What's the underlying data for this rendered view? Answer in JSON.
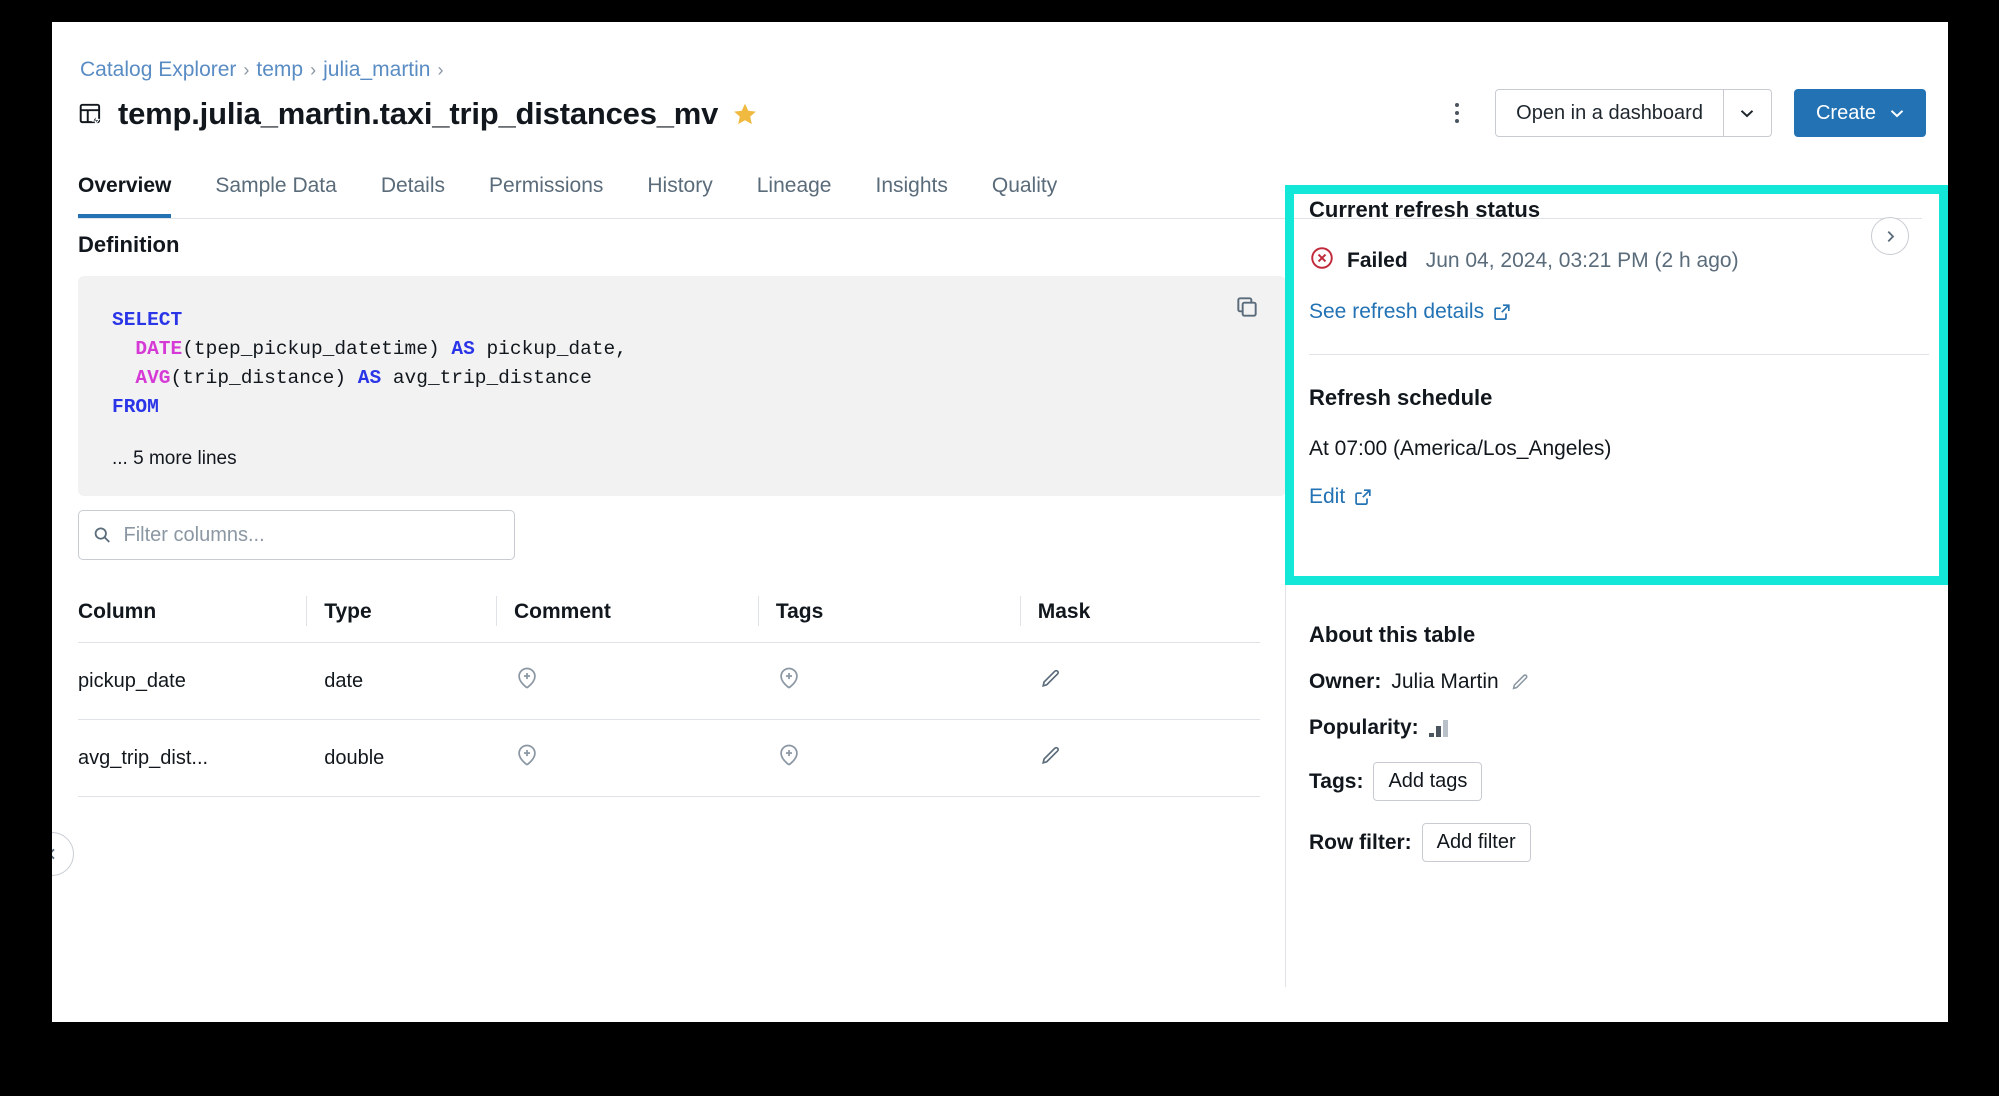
{
  "breadcrumb": {
    "items": [
      "Catalog Explorer",
      "temp",
      "julia_martin"
    ],
    "separator": "›"
  },
  "header": {
    "title": "temp.julia_martin.taxi_trip_distances_mv",
    "title_icon": "materialized-view-icon",
    "favorite_icon": "star-icon",
    "favorite_color": "#f0b93f",
    "kebab_icon": "more-vertical-icon",
    "open_dashboard_label": "Open in a dashboard",
    "create_label": "Create",
    "create_color": "#2272b4"
  },
  "tabs": [
    {
      "label": "Overview",
      "active": true
    },
    {
      "label": "Sample Data",
      "active": false
    },
    {
      "label": "Details",
      "active": false
    },
    {
      "label": "Permissions",
      "active": false
    },
    {
      "label": "History",
      "active": false
    },
    {
      "label": "Lineage",
      "active": false
    },
    {
      "label": "Insights",
      "active": false
    },
    {
      "label": "Quality",
      "active": false
    }
  ],
  "definition": {
    "heading": "Definition",
    "copy_icon": "copy-icon",
    "code_lines": [
      {
        "segments": [
          {
            "t": "SELECT",
            "c": "kw"
          }
        ]
      },
      {
        "segments": [
          {
            "t": "  ",
            "c": ""
          },
          {
            "t": "DATE",
            "c": "fn"
          },
          {
            "t": "(tpep_pickup_datetime) ",
            "c": ""
          },
          {
            "t": "AS",
            "c": "kw"
          },
          {
            "t": " pickup_date,",
            "c": ""
          }
        ]
      },
      {
        "segments": [
          {
            "t": "  ",
            "c": ""
          },
          {
            "t": "AVG",
            "c": "fn"
          },
          {
            "t": "(trip_distance) ",
            "c": ""
          },
          {
            "t": "AS",
            "c": "kw"
          },
          {
            "t": " avg_trip_distance",
            "c": ""
          }
        ]
      },
      {
        "segments": [
          {
            "t": "FROM",
            "c": "kw"
          }
        ]
      }
    ],
    "more_lines": "... 5 more lines"
  },
  "filter": {
    "placeholder": "Filter columns...",
    "value": "",
    "icon": "search-icon"
  },
  "columns_table": {
    "headers": [
      "Column",
      "Type",
      "Comment",
      "Tags",
      "Mask"
    ],
    "rows": [
      {
        "column": "pickup_date",
        "type": "date",
        "comment_icon": "add-comment-icon",
        "tags_icon": "add-tag-icon",
        "mask_icon": "pencil-icon"
      },
      {
        "column": "avg_trip_dist...",
        "type": "double",
        "comment_icon": "add-comment-icon",
        "tags_icon": "add-tag-icon",
        "mask_icon": "pencil-icon"
      }
    ]
  },
  "sidebar": {
    "refresh_status": {
      "heading": "Current refresh status",
      "expand_icon": "chevron-right-icon",
      "status": "Failed",
      "status_icon": "error-circle-icon",
      "status_color": "#c02a3a",
      "timestamp": "Jun 04, 2024, 03:21 PM (2 h ago)",
      "details_link": "See refresh details",
      "external_icon": "external-link-icon"
    },
    "refresh_schedule": {
      "heading": "Refresh schedule",
      "schedule_text": "At 07:00 (America/Los_Angeles)",
      "edit_link": "Edit",
      "external_icon": "external-link-icon"
    },
    "about": {
      "heading": "About this table",
      "owner_label": "Owner:",
      "owner_value": "Julia Martin",
      "owner_edit_icon": "pencil-icon",
      "popularity_label": "Popularity:",
      "popularity_icon": "bar-signal-icon",
      "tags_label": "Tags:",
      "add_tags_label": "Add tags",
      "row_filter_label": "Row filter:",
      "add_filter_label": "Add filter"
    }
  },
  "highlight": {
    "color": "#13e8d8"
  },
  "edge_handle": {
    "icon": "chevron-left-icon"
  }
}
